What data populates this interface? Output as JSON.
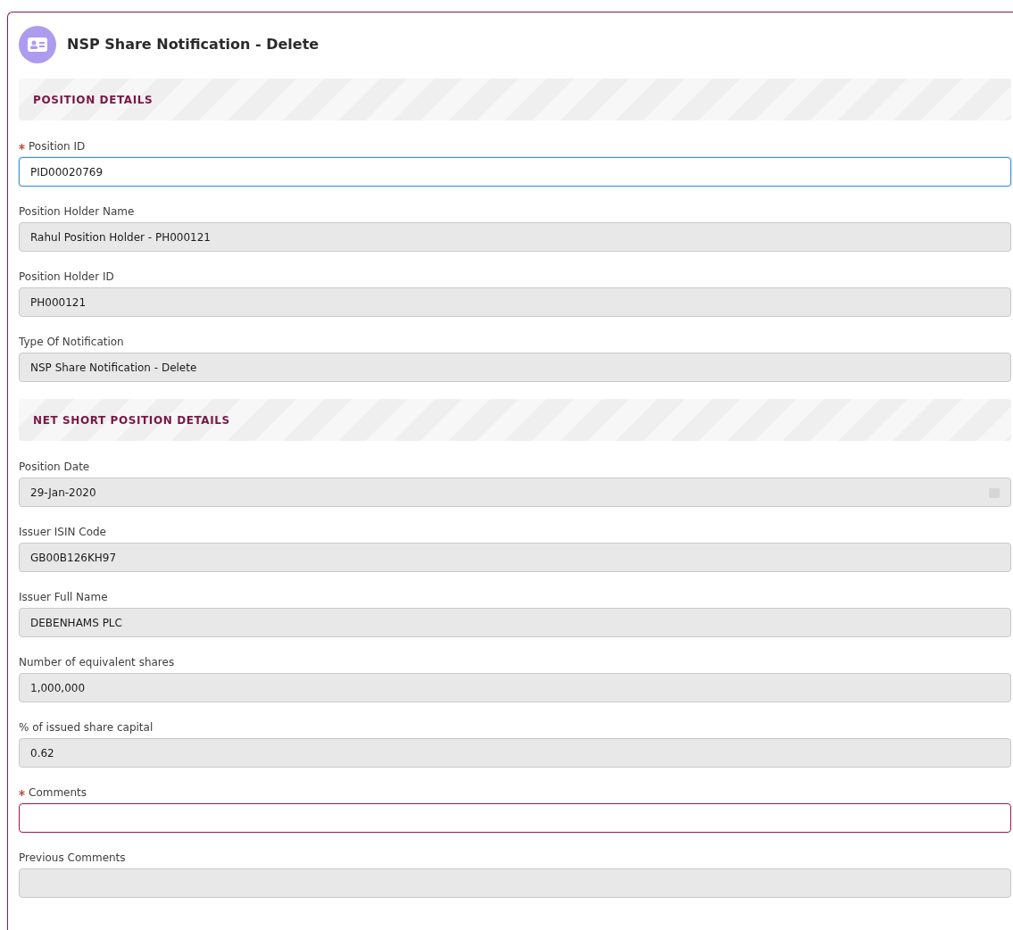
{
  "title": "NSP Share Notification - Delete",
  "sections": [
    {
      "title": "POSITION DETAILS",
      "fields": [
        {
          "label": "Position ID",
          "required": true,
          "kind": "editable",
          "focused": true,
          "invalid": false,
          "value": "PID00020769"
        },
        {
          "label": "Position Holder Name",
          "required": false,
          "kind": "readonly",
          "focused": false,
          "invalid": false,
          "value": "Rahul Position Holder - PH000121"
        },
        {
          "label": "Position Holder ID",
          "required": false,
          "kind": "readonly",
          "focused": false,
          "invalid": false,
          "value": "PH000121"
        },
        {
          "label": "Type Of Notification",
          "required": false,
          "kind": "readonly",
          "focused": false,
          "invalid": false,
          "value": "NSP Share Notification - Delete"
        }
      ]
    },
    {
      "title": "NET SHORT POSITION DETAILS",
      "fields": [
        {
          "label": "Position Date",
          "required": false,
          "kind": "date",
          "focused": false,
          "invalid": false,
          "value": "29-Jan-2020"
        },
        {
          "label": "Issuer ISIN Code",
          "required": false,
          "kind": "readonly",
          "focused": false,
          "invalid": false,
          "value": "GB00B126KH97"
        },
        {
          "label": "Issuer Full Name",
          "required": false,
          "kind": "readonly",
          "focused": false,
          "invalid": false,
          "value": "DEBENHAMS PLC"
        },
        {
          "label": "Number of equivalent shares",
          "required": false,
          "kind": "readonly",
          "focused": false,
          "invalid": false,
          "value": "1,000,000"
        },
        {
          "label": "% of issued share capital",
          "required": false,
          "kind": "readonly",
          "focused": false,
          "invalid": false,
          "value": "0.62"
        },
        {
          "label": "Comments",
          "required": true,
          "kind": "editable",
          "focused": false,
          "invalid": true
        },
        {
          "label": "Previous Comments",
          "required": false,
          "kind": "readonly",
          "focused": false,
          "invalid": false
        }
      ]
    }
  ]
}
